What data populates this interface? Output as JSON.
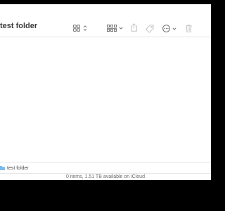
{
  "window": {
    "title": "test folder"
  },
  "toolbar": {
    "buttons": [
      {
        "id": "view",
        "icon": "icon-grid-view-icon",
        "has_chevron": true
      },
      {
        "id": "group",
        "icon": "group-by-icon",
        "has_chevron": true
      },
      {
        "id": "share",
        "icon": "share-icon"
      },
      {
        "id": "tag",
        "icon": "tag-icon"
      },
      {
        "id": "action",
        "icon": "ellipsis-circle-icon",
        "has_chevron": true
      },
      {
        "id": "delete",
        "icon": "trash-icon"
      }
    ]
  },
  "path_bar": {
    "items": [
      {
        "label": "test folder",
        "icon": "folder-icon"
      }
    ]
  },
  "status_bar": {
    "text": "0 items, 1.51 TB available on iCloud"
  },
  "colors": {
    "background": "#000000",
    "window": "#ffffff",
    "icon": "#707070",
    "icon_disabled": "#c2c2c2",
    "folder": "#5aa9e6"
  }
}
